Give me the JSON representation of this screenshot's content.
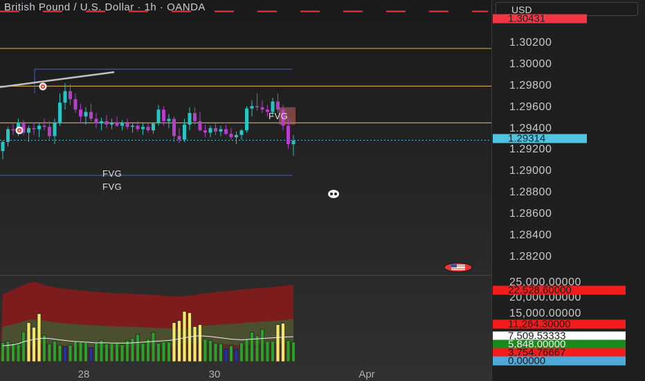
{
  "header": {
    "title": "British Pound / U.S. Dollar · 1h · OANDA"
  },
  "price_axis": {
    "currency": "USD",
    "ticks": [
      "1.30200",
      "1.30000",
      "1.29800",
      "1.29600",
      "1.29400",
      "1.29200",
      "1.29000",
      "1.28800",
      "1.28600",
      "1.28400",
      "1.28200"
    ],
    "top_label": "1.30431",
    "current_price": "1.29314"
  },
  "annotations": {
    "fvg_labels": [
      "FVG",
      "FVG",
      "FVG"
    ]
  },
  "volume_axis": {
    "ticks": [
      "25,000.00000",
      "20,000.00000",
      "15,000.00000"
    ],
    "labels": [
      "22,528.60000",
      "11,264.30000",
      "7,509.53333",
      "5,848.00000",
      "3,754.76667",
      "0.00000"
    ]
  },
  "time_axis": {
    "ticks": [
      "28",
      "30",
      "Apr"
    ]
  },
  "colors": {
    "up": "#26c6c6",
    "down": "#b63fc9",
    "red_label": "#f23645",
    "current_label": "#4fc3e0",
    "green_label": "#1b8a1b",
    "orange_line": "#d0a040",
    "blue_line": "#3f63d9"
  },
  "chart_data": {
    "type": "candlestick",
    "price_range": [
      1.2814,
      1.3053
    ],
    "candles": [
      [
        1.2922,
        1.2931,
        1.2915,
        1.293
      ],
      [
        1.293,
        1.2943,
        1.2926,
        1.2941
      ],
      [
        1.2941,
        1.2946,
        1.2936,
        1.294
      ],
      [
        1.294,
        1.295,
        1.2935,
        1.2946
      ],
      [
        1.2946,
        1.2949,
        1.2936,
        1.2938
      ],
      [
        1.2938,
        1.2944,
        1.293,
        1.2942
      ],
      [
        1.2942,
        1.2947,
        1.2936,
        1.2941
      ],
      [
        1.2941,
        1.2946,
        1.2934,
        1.2944
      ],
      [
        1.2944,
        1.295,
        1.294,
        1.2943
      ],
      [
        1.2943,
        1.2948,
        1.2932,
        1.2935
      ],
      [
        1.2935,
        1.295,
        1.2928,
        1.2947
      ],
      [
        1.2947,
        1.2972,
        1.2944,
        1.2964
      ],
      [
        1.2964,
        1.2981,
        1.2958,
        1.2974
      ],
      [
        1.2974,
        1.298,
        1.2962,
        1.2967
      ],
      [
        1.2967,
        1.2972,
        1.2955,
        1.2958
      ],
      [
        1.2958,
        1.2963,
        1.2946,
        1.2952
      ],
      [
        1.2952,
        1.296,
        1.2945,
        1.2956
      ],
      [
        1.2956,
        1.2963,
        1.2948,
        1.295
      ],
      [
        1.295,
        1.2955,
        1.2942,
        1.2946
      ],
      [
        1.2946,
        1.2951,
        1.294,
        1.2948
      ],
      [
        1.2948,
        1.2953,
        1.2942,
        1.2945
      ],
      [
        1.2945,
        1.295,
        1.2941,
        1.2947
      ],
      [
        1.2947,
        1.2952,
        1.2943,
        1.2944
      ],
      [
        1.2944,
        1.2949,
        1.294,
        1.2946
      ],
      [
        1.2946,
        1.295,
        1.2941,
        1.2943
      ],
      [
        1.2943,
        1.2947,
        1.2938,
        1.2944
      ],
      [
        1.2944,
        1.2948,
        1.2939,
        1.2941
      ],
      [
        1.2941,
        1.2946,
        1.2936,
        1.2943
      ],
      [
        1.2943,
        1.2947,
        1.2938,
        1.294
      ],
      [
        1.294,
        1.2945,
        1.2937,
        1.2946
      ],
      [
        1.2946,
        1.2962,
        1.2944,
        1.2958
      ],
      [
        1.2958,
        1.2961,
        1.2944,
        1.2948
      ],
      [
        1.2948,
        1.2954,
        1.2942,
        1.295
      ],
      [
        1.295,
        1.2952,
        1.293,
        1.2935
      ],
      [
        1.2935,
        1.2942,
        1.2929,
        1.2932
      ],
      [
        1.2932,
        1.295,
        1.293,
        1.2945
      ],
      [
        1.2945,
        1.296,
        1.294,
        1.2955
      ],
      [
        1.2955,
        1.296,
        1.2945,
        1.2948
      ],
      [
        1.2948,
        1.2956,
        1.2939,
        1.294
      ],
      [
        1.294,
        1.2945,
        1.2934,
        1.2938
      ],
      [
        1.2938,
        1.2944,
        1.2934,
        1.2942
      ],
      [
        1.2942,
        1.2946,
        1.2936,
        1.2939
      ],
      [
        1.2939,
        1.2944,
        1.2935,
        1.2941
      ],
      [
        1.2941,
        1.2945,
        1.2936,
        1.2937
      ],
      [
        1.2937,
        1.2942,
        1.2932,
        1.2934
      ],
      [
        1.2934,
        1.2939,
        1.2928,
        1.2936
      ],
      [
        1.2936,
        1.2941,
        1.2932,
        1.294
      ],
      [
        1.294,
        1.2961,
        1.2938,
        1.2959
      ],
      [
        1.2959,
        1.2966,
        1.2952,
        1.2961
      ],
      [
        1.2961,
        1.2972,
        1.2957,
        1.296
      ],
      [
        1.296,
        1.2966,
        1.2955,
        1.2958
      ],
      [
        1.2958,
        1.2962,
        1.2952,
        1.2956
      ],
      [
        1.2956,
        1.2968,
        1.2952,
        1.2965
      ],
      [
        1.2965,
        1.2972,
        1.2955,
        1.2958
      ],
      [
        1.2958,
        1.2962,
        1.294,
        1.2944
      ],
      [
        1.2944,
        1.295,
        1.2924,
        1.2928
      ],
      [
        1.2928,
        1.2936,
        1.2918,
        1.2931
      ]
    ],
    "volume": {
      "range": [
        0,
        26000
      ],
      "bars": [
        5800,
        6200,
        5600,
        5200,
        9000,
        11800,
        10400,
        14500,
        8000,
        5400,
        6200,
        5000,
        4500,
        5000,
        6200,
        5900,
        5800,
        4200,
        5800,
        6500,
        5400,
        5500,
        5600,
        5100,
        6400,
        7100,
        8200,
        5600,
        6800,
        8800,
        5500,
        6000,
        5900,
        11800,
        12400,
        15200,
        14800,
        10600,
        11200,
        6800,
        6400,
        5600,
        5400,
        3900,
        4800,
        3700,
        5700,
        6700,
        8900,
        7800,
        9800,
        6100,
        6200,
        11200,
        11600,
        6400,
        5900
      ],
      "avg": [
        4800,
        4900,
        5100,
        5400,
        6000,
        6400,
        6700,
        7000,
        7100,
        7000,
        6800,
        6600,
        6400,
        6200,
        6100,
        6000,
        5900,
        5800,
        5700,
        5700,
        5700,
        5600,
        5600,
        5600,
        5600,
        5700,
        5800,
        5900,
        6000,
        6100,
        6200,
        6300,
        6400,
        6600,
        6900,
        7200,
        7500,
        7700,
        7800,
        7700,
        7600,
        7400,
        7200,
        7000,
        6800,
        6700,
        6600,
        6700,
        6800,
        6900,
        7000,
        7100,
        7200,
        7300,
        7400,
        7500,
        7500
      ],
      "band_upper": [
        20500,
        21000,
        21800,
        22400,
        23200,
        23800,
        24100,
        23800,
        23200,
        22800,
        22500,
        22200,
        22000,
        21900,
        21700,
        21500,
        21300,
        21200,
        21100,
        21000,
        20900,
        20800,
        20700,
        20700,
        20600,
        20500,
        20400,
        20400,
        20300,
        20200,
        20100,
        20000,
        19800,
        19700,
        19700,
        19800,
        20000,
        20200,
        20500,
        20700,
        20900,
        21000,
        21200,
        21300,
        21500,
        21600,
        21800,
        22000,
        22100,
        22200,
        22300,
        22400,
        22500,
        22700,
        22900,
        23100,
        23300
      ],
      "band_lower": [
        10500,
        10900,
        11300,
        11700,
        12200,
        12600,
        12800,
        12700,
        12400,
        12100,
        11900,
        11700,
        11500,
        11400,
        11300,
        11200,
        11100,
        11000,
        10900,
        10900,
        10800,
        10700,
        10700,
        10600,
        10600,
        10500,
        10400,
        10400,
        10300,
        10200,
        10200,
        10100,
        10000,
        10000,
        10000,
        10100,
        10300,
        10500,
        10700,
        10900,
        11000,
        11100,
        11200,
        11300,
        11400,
        11500,
        11600,
        11800,
        11900,
        12000,
        12100,
        12200,
        12300,
        12400,
        12500,
        12700,
        12900
      ]
    }
  }
}
